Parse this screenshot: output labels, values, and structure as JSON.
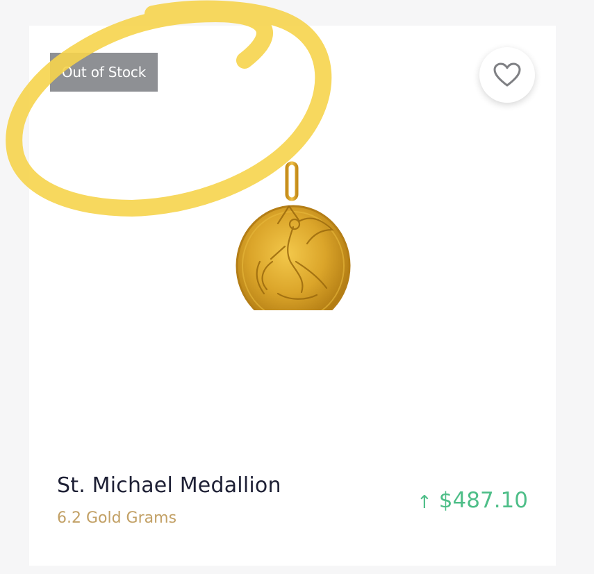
{
  "product": {
    "badge_label": "Out of Stock",
    "favorite_icon": "heart-outline-icon",
    "image_subject": "gold-medallion-pendant",
    "name": "St. Michael Medallion",
    "weight": "6.2 Gold Grams",
    "price": "$487.10",
    "price_trend_icon": "↑"
  },
  "colors": {
    "page_background": "#f6f6f7",
    "card_background": "#ffffff",
    "badge_background": "#8e9094",
    "title": "#1e2035",
    "weight": "#c2a065",
    "price": "#4ebe88",
    "highlight_annotation": "#f6d44c",
    "gold": "#d9a82e"
  }
}
